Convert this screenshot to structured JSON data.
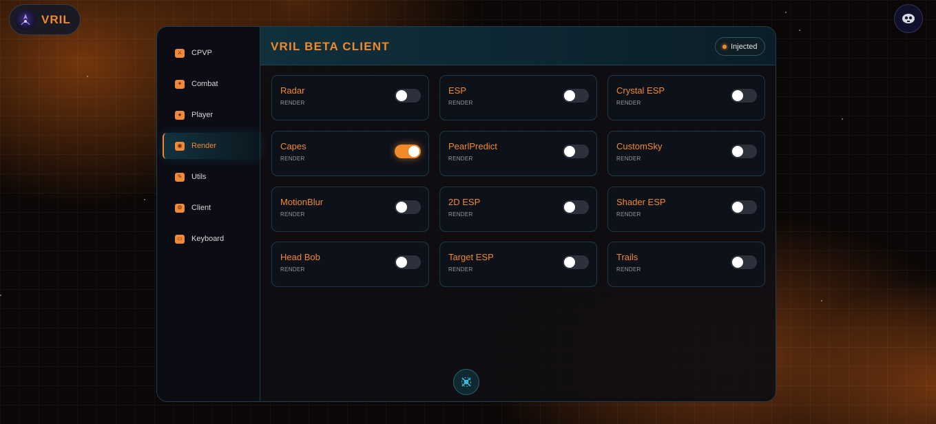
{
  "brand": {
    "name": "VRIL",
    "logo_icon": "vril-logo-icon"
  },
  "avatar": {
    "icon": "user-avatar-icon"
  },
  "sidebar": {
    "items": [
      {
        "label": "CPVP",
        "icon": "sword-icon",
        "glyph": "⚔",
        "active": false
      },
      {
        "label": "Combat",
        "icon": "combat-icon",
        "glyph": "✦",
        "active": false
      },
      {
        "label": "Player",
        "icon": "player-icon",
        "glyph": "●",
        "active": false
      },
      {
        "label": "Render",
        "icon": "render-icon",
        "glyph": "◉",
        "active": true
      },
      {
        "label": "Utils",
        "icon": "utils-icon",
        "glyph": "✎",
        "active": false
      },
      {
        "label": "Client",
        "icon": "client-icon",
        "glyph": "⚙",
        "active": false
      },
      {
        "label": "Keyboard",
        "icon": "keyboard-icon",
        "glyph": "▭",
        "active": false
      }
    ]
  },
  "header": {
    "title": "VRIL BETA CLIENT",
    "status": "Injected"
  },
  "modules": [
    {
      "name": "Radar",
      "category": "RENDER",
      "enabled": false
    },
    {
      "name": "ESP",
      "category": "RENDER",
      "enabled": false
    },
    {
      "name": "Crystal ESP",
      "category": "RENDER",
      "enabled": false
    },
    {
      "name": "Capes",
      "category": "RENDER",
      "enabled": true
    },
    {
      "name": "PearlPredict",
      "category": "RENDER",
      "enabled": false
    },
    {
      "name": "CustomSky",
      "category": "RENDER",
      "enabled": false
    },
    {
      "name": "MotionBlur",
      "category": "RENDER",
      "enabled": false
    },
    {
      "name": "2D ESP",
      "category": "RENDER",
      "enabled": false
    },
    {
      "name": "Shader ESP",
      "category": "RENDER",
      "enabled": false
    },
    {
      "name": "Head Bob",
      "category": "RENDER",
      "enabled": false
    },
    {
      "name": "Target ESP",
      "category": "RENDER",
      "enabled": false
    },
    {
      "name": "Trails",
      "category": "RENDER",
      "enabled": false
    }
  ],
  "bottom_button": {
    "icon": "radar-scan-icon"
  },
  "colors": {
    "accent": "#f28a2c",
    "panel_border": "#1f3f4c",
    "card_bg": "#0d1119",
    "toggle_off": "#2c313c"
  }
}
